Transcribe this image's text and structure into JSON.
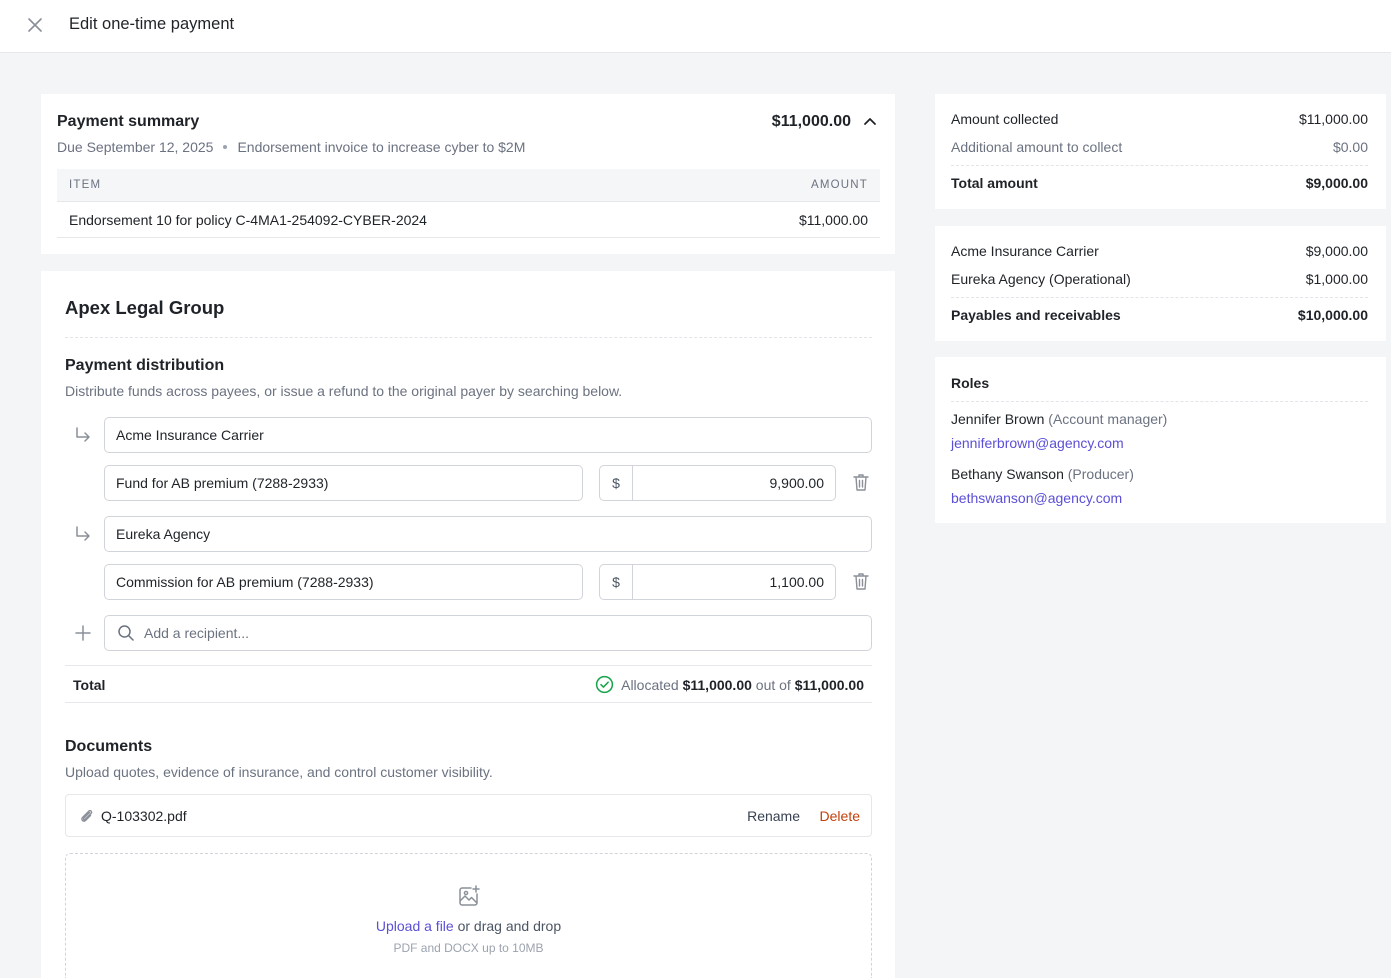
{
  "header": {
    "title": "Edit one-time payment",
    "close_icon": "close-icon"
  },
  "summary": {
    "title": "Payment summary",
    "total": "$11,000.00",
    "due": "Due September 12, 2025",
    "description": "Endorsement invoice to increase cyber to $2M",
    "columns": [
      "ITEM",
      "AMOUNT"
    ],
    "rows": [
      {
        "item": "Endorsement 10 for policy C-4MA1-254092-CYBER-2024",
        "amount": "$11,000.00"
      }
    ]
  },
  "main": {
    "org_name": "Apex Legal Group",
    "distribution": {
      "title": "Payment distribution",
      "subtitle": "Distribute funds across payees, or issue a refund to the original payer by searching below.",
      "payees": [
        {
          "name": "Acme Insurance Carrier",
          "memo": "Fund for AB premium (7288-2933)",
          "currency": "$",
          "amount": "9,900.00"
        },
        {
          "name": "Eureka Agency",
          "memo": "Commission for AB premium (7288-2933)",
          "currency": "$",
          "amount": "1,100.00"
        }
      ],
      "add_recipient_placeholder": "Add a recipient...",
      "total_label": "Total",
      "allocated_prefix": "Allocated",
      "allocated_amount": "$11,000.00",
      "out_of": "out of",
      "total_amount": "$11,000.00"
    },
    "documents": {
      "title": "Documents",
      "subtitle": "Upload quotes, evidence of insurance, and control customer visibility.",
      "files": [
        {
          "name": "Q-103302.pdf",
          "rename": "Rename",
          "delete": "Delete"
        }
      ],
      "upload_link": "Upload a file",
      "upload_text": "or drag and drop",
      "upload_hint": "PDF and DOCX up to 10MB"
    }
  },
  "amounts_card": {
    "rows": [
      {
        "label": "Amount collected",
        "value": "$11,000.00"
      },
      {
        "label": "Additional amount to collect",
        "value": "$0.00"
      }
    ],
    "total_label": "Total amount",
    "total_value": "$9,000.00"
  },
  "payables_card": {
    "rows": [
      {
        "label": "Acme Insurance Carrier",
        "value": "$9,000.00"
      },
      {
        "label": "Eureka Agency (Operational)",
        "value": "$1,000.00"
      }
    ],
    "total_label": "Payables and receivables",
    "total_value": "$10,000.00"
  },
  "roles": {
    "title": "Roles",
    "people": [
      {
        "name": "Jennifer Brown",
        "role": "(Account manager)",
        "email": "jenniferbrown@agency.com"
      },
      {
        "name": "Bethany Swanson",
        "role": "(Producer)",
        "email": "bethswanson@agency.com"
      }
    ]
  },
  "colors": {
    "accent": "#5b4fd6",
    "danger": "#c2410c",
    "success": "#16a34a",
    "background": "#f4f5f7"
  }
}
